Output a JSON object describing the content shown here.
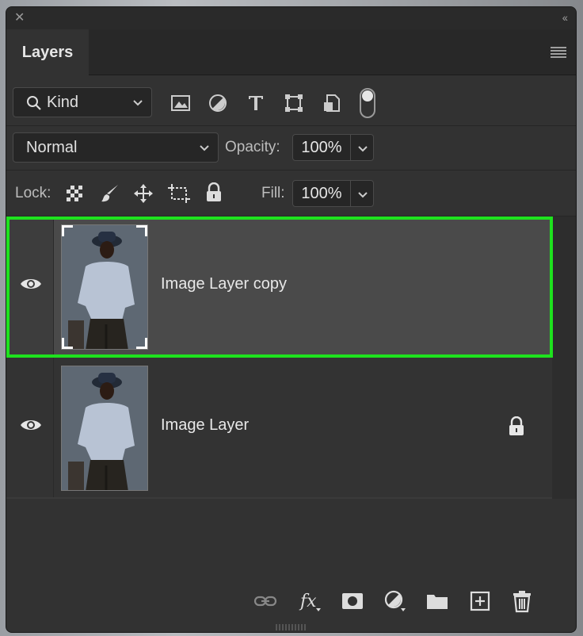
{
  "panel": {
    "tab_label": "Layers"
  },
  "filter": {
    "kind_label": "Kind"
  },
  "blend": {
    "mode": "Normal",
    "opacity_label": "Opacity:",
    "opacity_value": "100%"
  },
  "lock": {
    "label": "Lock:",
    "fill_label": "Fill:",
    "fill_value": "100%"
  },
  "layers": [
    {
      "name": "Image Layer copy",
      "visible": true,
      "selected": true,
      "locked": false
    },
    {
      "name": "Image Layer",
      "visible": true,
      "selected": false,
      "locked": true
    }
  ],
  "colors": {
    "highlight": "#1ee21e",
    "panel_bg": "#323232"
  }
}
